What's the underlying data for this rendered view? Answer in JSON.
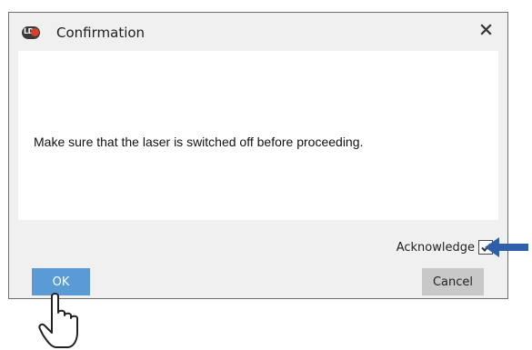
{
  "dialog": {
    "logo_text": "LD",
    "title": "Confirmation",
    "close_symbol": "×",
    "message": "Make sure that the laser is switched off before proceeding.",
    "acknowledge_label": "Acknowledge",
    "acknowledge_checked": true,
    "ok_label": "OK",
    "cancel_label": "Cancel"
  },
  "annotations": {
    "arrow_icon": "left-arrow-icon",
    "pointer_icon": "hand-pointer-icon"
  },
  "colors": {
    "ok_button": "#5b9bd5",
    "cancel_button": "#c8c8c8",
    "arrow": "#2f5fa8",
    "logo_accent": "#d9402c"
  }
}
